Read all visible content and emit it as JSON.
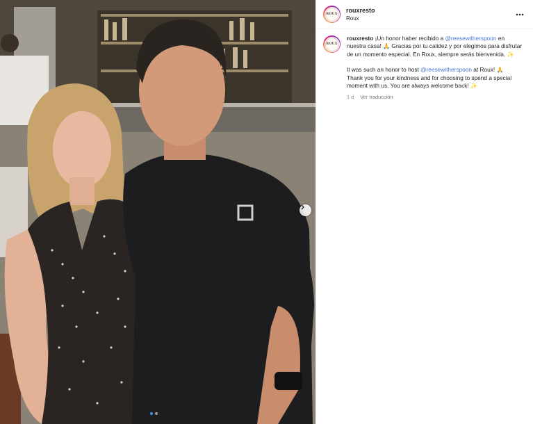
{
  "post": {
    "username": "rouxresto",
    "location": "Roux",
    "avatar_text": "ROUX",
    "more_icon": "more-horizontal-icon"
  },
  "caption": {
    "username": "rouxresto",
    "es_part1": "¡Un honor haber recibido a ",
    "es_mention": "@reesewitherspoon",
    "es_part2": " en nuestra casa! ",
    "es_emoji1": "🙏",
    "es_part3": " Gracias por tu calidez y por elegimos para disfrutar de un momento especial. En Roux, siempre serás bienvenida. ",
    "es_emoji2": "✨",
    "en_part1": "It was such an honor to host ",
    "en_mention": "@reesewitherspoon",
    "en_part2": " at Roux! ",
    "en_emoji1": "🙏",
    "en_part3": "Thank you for your kindness and for choosing to spend a special moment with us. You are always welcome back! ",
    "en_emoji2": "✨",
    "time": "1 d",
    "translate": "Ver traducción"
  },
  "carousel": {
    "current": 1,
    "total": 2,
    "next_icon": "chevron-right-icon"
  },
  "colors": {
    "accent": "#3897f0",
    "mention": "#4a76d6",
    "muted": "#8e8e8e"
  }
}
